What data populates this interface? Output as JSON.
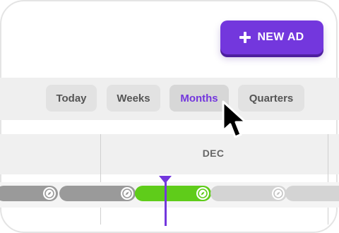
{
  "actions": {
    "new_ad_label": "NEW AD",
    "icon": "plus-icon"
  },
  "view_toggle": {
    "selected": "Months",
    "options": [
      "Today",
      "Weeks",
      "Months",
      "Quarters"
    ]
  },
  "timeline": {
    "month_label": "DEC",
    "bars": [
      {
        "status": "inactive",
        "icon": "compass-icon"
      },
      {
        "status": "inactive",
        "icon": "compass-icon"
      },
      {
        "status": "active",
        "icon": "compass-icon"
      },
      {
        "status": "upcoming",
        "icon": "compass-icon"
      },
      {
        "status": "upcoming",
        "icon": "compass-icon"
      }
    ]
  },
  "colors": {
    "accent": "#7337dd",
    "active_bar": "#5fcc1a",
    "inactive_bar": "#9a9a9a",
    "upcoming_bar": "#d4d4d4"
  }
}
